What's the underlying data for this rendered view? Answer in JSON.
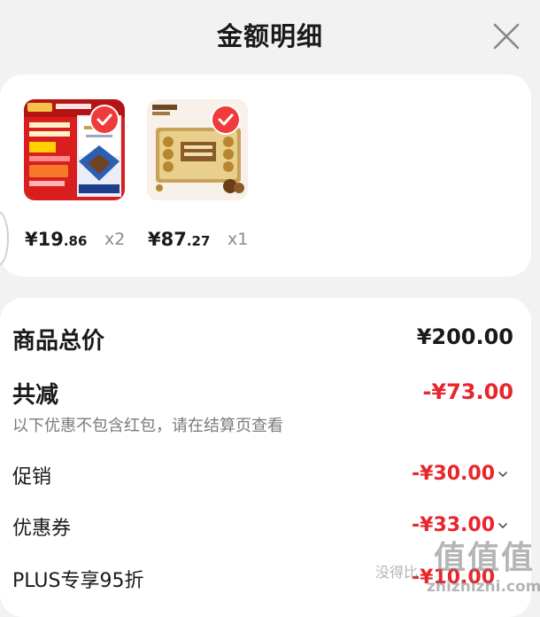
{
  "header": {
    "title": "金额明细"
  },
  "products": [
    {
      "price_int": "¥19",
      "price_dec": ".86",
      "qty": "x2"
    },
    {
      "price_int": "¥87",
      "price_dec": ".27",
      "qty": "x1"
    }
  ],
  "summary": {
    "total_label": "商品总价",
    "total_value": "¥200.00",
    "discount_label": "共减",
    "discount_value": "-¥73.00",
    "note": "以下优惠不包含红包，请在结算页查看",
    "items": [
      {
        "label": "促销",
        "value": "-¥30.00"
      },
      {
        "label": "优惠券",
        "value": "-¥33.00"
      },
      {
        "label": "PLUS专享95折",
        "value": "-¥10.00"
      }
    ]
  },
  "watermark": {
    "text": "值值值",
    "line1": "没得比",
    "line2": "zhizhizhi.com"
  },
  "colors": {
    "accent_red": "#e8262b",
    "check_red": "#ef3b3b",
    "muted": "#7a7a7a"
  },
  "icons": {
    "close": "close-icon",
    "check": "check-icon",
    "chevron": "chevron-down-icon"
  }
}
